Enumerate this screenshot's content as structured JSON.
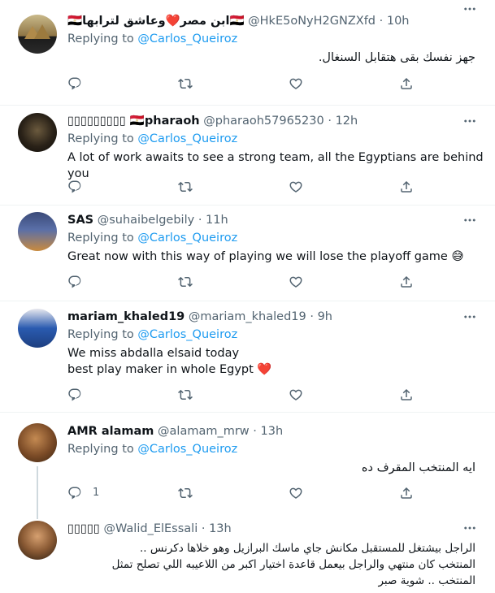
{
  "tweets": [
    {
      "name": "🇪🇬ابن مصر❤️وعاشق لترابها🇪🇬",
      "handle": "@HkE5oNyH2GNZXfd",
      "dot": "·",
      "time": "10h",
      "replying_prefix": "Replying to ",
      "replying_to": "@Carlos_Queiroz",
      "text": "جهز نفسك بقى هتقابل السنغال.",
      "reply_count": ""
    },
    {
      "name": "▯▯▯▯▯▯▯▯▯ 🇪🇬pharaoh",
      "handle": "@pharaoh57965230",
      "dot": "·",
      "time": "12h",
      "replying_prefix": "Replying to ",
      "replying_to": "@Carlos_Queiroz",
      "text": "A lot of work awaits to see a strong team, all the Egyptians are behind you",
      "reply_count": ""
    },
    {
      "name": "SAS",
      "handle": "@suhaibelgebily",
      "dot": "·",
      "time": "11h",
      "replying_prefix": "Replying to ",
      "replying_to": "@Carlos_Queiroz",
      "text": "Great now with this way of playing we will lose the playoff game 😅",
      "reply_count": ""
    },
    {
      "name": "mariam_khaled19",
      "handle": "@mariam_khaled19",
      "dot": "·",
      "time": "9h",
      "replying_prefix": "Replying to ",
      "replying_to": "@Carlos_Queiroz",
      "text_line1": "We miss abdalla elsaid today",
      "text_line2": "best play maker in whole Egypt",
      "heart": "❤️",
      "reply_count": ""
    },
    {
      "name": "AMR alamam",
      "handle": "@alamam_mrw",
      "dot": "·",
      "time": "13h",
      "replying_prefix": "Replying to ",
      "replying_to": "@Carlos_Queiroz",
      "text": "ايه المنتخب المقرف ده",
      "reply_count": "1"
    },
    {
      "name": "▯▯▯▯▯",
      "handle": "@Walid_ElEssali",
      "dot": "·",
      "time": "13h",
      "text_line1": "الراجل بيشتغل للمستقبل مكانش جاي ماسك البرازيل وهو خلاها دكرنس ..",
      "text_line2": "المنتخب كان منتهي والراجل بيعمل قاعدة اختيار اكبر من اللاعيبه اللي تصلح تمثل",
      "text_line3": "المنتخب .. شوية صبر"
    }
  ],
  "icons": {
    "reply": "reply-icon",
    "retweet": "retweet-icon",
    "like": "like-icon",
    "share": "share-icon",
    "more": "more-icon"
  },
  "colors": {
    "link": "#1d9bf0",
    "muted": "#536471",
    "text": "#0f1419",
    "divider": "#eff3f4",
    "heart": "#e0245e"
  }
}
